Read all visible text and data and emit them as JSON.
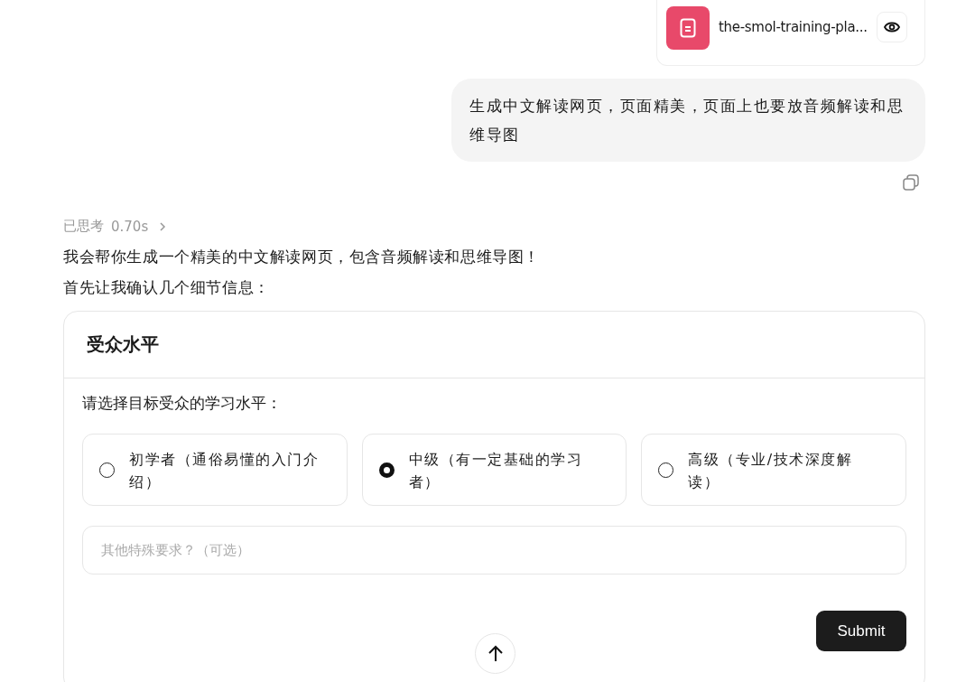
{
  "attachment": {
    "file_name": "the-smol-training-pla..."
  },
  "user_message": {
    "text": "生成中文解读网页，页面精美，页面上也要放音频解读和思维导图"
  },
  "thinking": {
    "label": "已思考",
    "duration": "0.70s",
    "expanded": false
  },
  "assistant_paragraphs": [
    "我会帮你生成一个精美的中文解读网页，包含音频解读和思维导图！",
    "首先让我确认几个细节信息："
  ],
  "question_panel": {
    "title": "受众水平",
    "question": "请选择目标受众的学习水平：",
    "options": [
      {
        "label": "初学者（通俗易懂的入门介绍）",
        "selected": false
      },
      {
        "label": "中级（有一定基础的学习者）",
        "selected": true
      },
      {
        "label": "高级（专业/技术深度解读）",
        "selected": false
      }
    ],
    "extra_field": {
      "placeholder": "其他特殊要求？（可选）"
    },
    "submit_button": "Submit"
  }
}
